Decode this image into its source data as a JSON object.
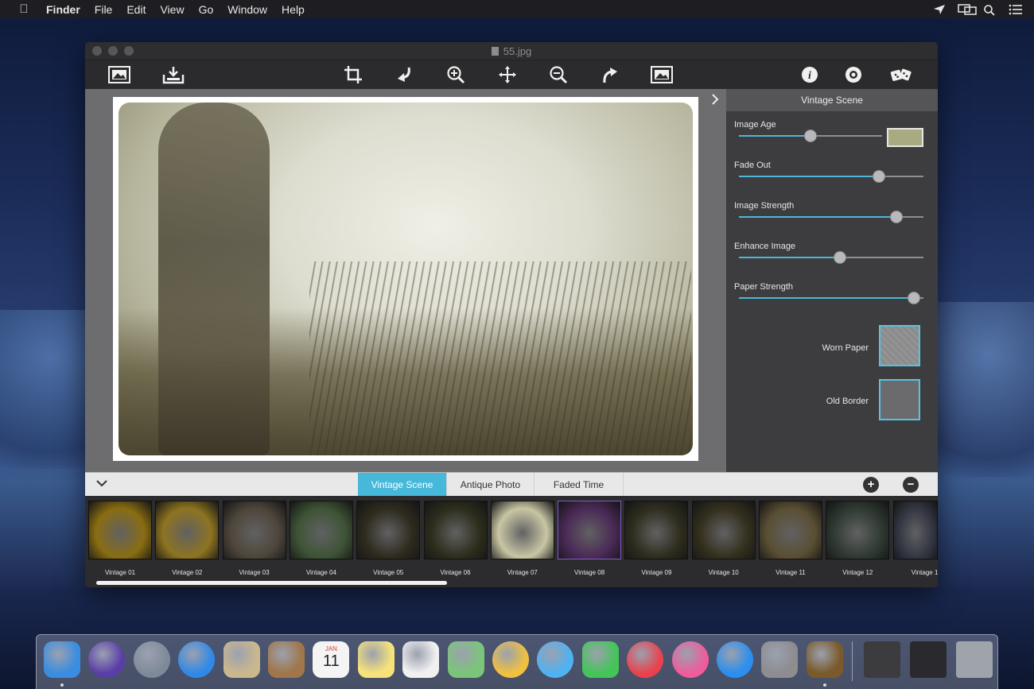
{
  "menubar": {
    "app_name": "Finder",
    "items": [
      "File",
      "Edit",
      "View",
      "Go",
      "Window",
      "Help"
    ]
  },
  "window": {
    "title": "55.jpg"
  },
  "toolbar": {
    "buttons": [
      "open-image-icon",
      "save-icon",
      "crop-icon",
      "rotate-left-icon",
      "zoom-in-icon",
      "move-icon",
      "zoom-out-icon",
      "rotate-right-icon",
      "fit-image-icon",
      "info-icon",
      "settings-icon",
      "random-dice-icon"
    ]
  },
  "panel": {
    "title": "Vintage Scene",
    "sliders": [
      {
        "label": "Image Age",
        "value": 0.5
      },
      {
        "label": "Fade Out",
        "value": 0.78
      },
      {
        "label": "Image Strength",
        "value": 0.88
      },
      {
        "label": "Enhance Image",
        "value": 0.55
      },
      {
        "label": "Paper Strength",
        "value": 0.98
      }
    ],
    "image_age_color": "#a9aa80",
    "textures": [
      {
        "label": "Worn Paper"
      },
      {
        "label": "Old Border"
      }
    ]
  },
  "tabs": {
    "items": [
      "Vintage Scene",
      "Antique Photo",
      "Faded Time"
    ],
    "active": "Vintage Scene"
  },
  "thumbnails": [
    {
      "label": "Vintage 01",
      "color": "#8a6d12"
    },
    {
      "label": "Vintage 02",
      "color": "#8e7420"
    },
    {
      "label": "Vintage 03",
      "color": "#4e463b"
    },
    {
      "label": "Vintage 04",
      "color": "#3e5436"
    },
    {
      "label": "Vintage 05",
      "color": "#2e2b1e"
    },
    {
      "label": "Vintage 06",
      "color": "#2d2e1c"
    },
    {
      "label": "Vintage 07",
      "color": "#c9c6a4"
    },
    {
      "label": "Vintage 08",
      "color": "#4b2a57"
    },
    {
      "label": "Vintage 09",
      "color": "#2f2d1e"
    },
    {
      "label": "Vintage 10",
      "color": "#34301e"
    },
    {
      "label": "Vintage 11",
      "color": "#5a4f34"
    },
    {
      "label": "Vintage 12",
      "color": "#2f3a32"
    },
    {
      "label": "Vintage 1",
      "color": "#343743"
    }
  ],
  "dock": {
    "apps": [
      {
        "name": "finder-icon",
        "color": "#3a8de0"
      },
      {
        "name": "siri-icon",
        "color": "#5a3ea8"
      },
      {
        "name": "launchpad-icon",
        "color": "#7f8a98"
      },
      {
        "name": "safari-icon",
        "color": "#2f89e8"
      },
      {
        "name": "mail-icon",
        "color": "#c9b88e"
      },
      {
        "name": "contacts-icon",
        "color": "#a0764a"
      },
      {
        "name": "calendar-icon",
        "color": "#f4f4f4"
      },
      {
        "name": "notes-icon",
        "color": "#f5e27a"
      },
      {
        "name": "reminders-icon",
        "color": "#f0f0f0"
      },
      {
        "name": "maps-icon",
        "color": "#7bc57a"
      },
      {
        "name": "photos-icon",
        "color": "#f0c040"
      },
      {
        "name": "messages-icon",
        "color": "#4fb2f2"
      },
      {
        "name": "facetime-icon",
        "color": "#45c45a"
      },
      {
        "name": "news-icon",
        "color": "#e8424e"
      },
      {
        "name": "itunes-icon",
        "color": "#ee5c9c"
      },
      {
        "name": "app-store-icon",
        "color": "#2b8ef0"
      },
      {
        "name": "system-preferences-icon",
        "color": "#8d8d90"
      },
      {
        "name": "vintage-scene-app-icon",
        "color": "#7a5a2a"
      }
    ],
    "right_items": [
      {
        "name": "photos-stack-icon",
        "color": "#3c3c3e"
      },
      {
        "name": "screenshot-stack-icon",
        "color": "#2a2a2e"
      },
      {
        "name": "trash-icon",
        "color": "#9fa4ab"
      }
    ],
    "calendar_month": "JAN",
    "calendar_day": "11"
  }
}
